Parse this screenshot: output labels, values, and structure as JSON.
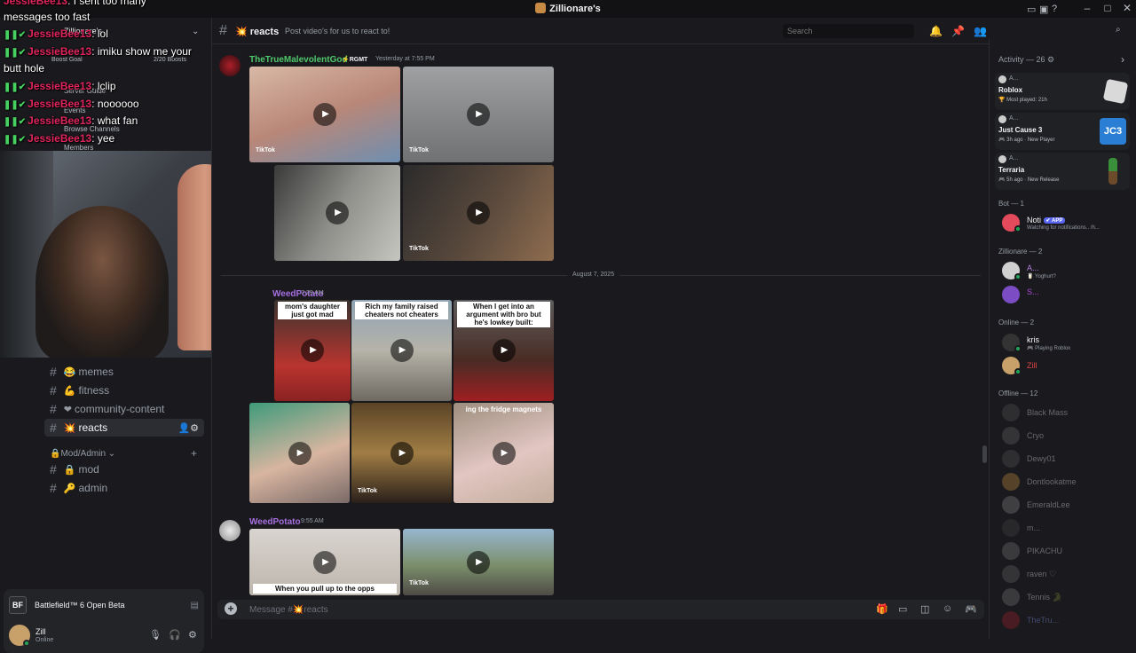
{
  "window": {
    "title": "Zillionare's"
  },
  "sidebar": {
    "channels": [
      {
        "emoji": "😂",
        "label": "memes",
        "top": 0
      },
      {
        "emoji": "💪",
        "label": "fitness"
      },
      {
        "emoji": "❤",
        "label": "community-content"
      },
      {
        "emoji": "💥",
        "label": "reacts",
        "active": true
      }
    ],
    "category": "Mod/Admin",
    "admin_channels": [
      {
        "emoji": "🔒",
        "label": "mod"
      },
      {
        "emoji": "🔑",
        "label": "admin"
      }
    ],
    "under_overlay": {
      "server_name": "Zillionare's",
      "boost_goal": "Boost Goal",
      "boosts": "2/20 Boosts",
      "server_guide": "Server Guide",
      "events": "Events",
      "browse": "Browse Channels",
      "members": "Members"
    }
  },
  "stream_chat": [
    {
      "name": "JessieBee13",
      "text": ": I sent too many"
    },
    {
      "name": "",
      "text": "messages too fast"
    },
    {
      "name": "JessieBee13",
      "text": ": lol"
    },
    {
      "name": "JessieBee13",
      "text": ": imiku show me your"
    },
    {
      "name": "",
      "text": "butt hole"
    },
    {
      "name": "JessieBee13",
      "text": ": lclip"
    },
    {
      "name": "JessieBee13",
      "text": ": noooooo"
    },
    {
      "name": "JessieBee13",
      "text": ": what fan"
    },
    {
      "name": "JessieBee13",
      "text": ": yee"
    }
  ],
  "game_activity": {
    "name": "Battlefield™ 6 Open Beta",
    "icon_text": "BF"
  },
  "user": {
    "name": "Zill",
    "status": "Online"
  },
  "channel_header": {
    "name": "reacts",
    "emoji": "💥",
    "topic": "Post video's for us to react to!"
  },
  "search": {
    "placeholder": "Search"
  },
  "messages": [
    {
      "author": "TheTrueMalevolentGod",
      "tag": "⚡RGMT",
      "time": "Yesterday at 7:55 PM"
    },
    {
      "author": "WeedPotato",
      "time": "7:29 AM"
    },
    {
      "author": "WeedPotato",
      "time": "9:55 AM"
    }
  ],
  "captions": {
    "v1": "mom's daughter just got mad",
    "v2": "Rich my family raised cheaters not cheaters",
    "v3": "When I get into an argument with bro but he's lowkey built:",
    "v4": "ing the fridge magnets",
    "v5": "When you pull up to the opps"
  },
  "tiktok": {
    "label": "TikTok"
  },
  "date_divider": "August 7, 2025",
  "composer": {
    "placeholder": "Message #💥reacts"
  },
  "activity": {
    "header": "Activity — 26",
    "cards": [
      {
        "who": "A...",
        "game": "Roblox",
        "meta": "Most played: 21h",
        "art": "#d9d9d9"
      },
      {
        "who": "A...",
        "game": "Just Cause 3",
        "meta": "3h ago · New Player",
        "art": "#2a7fd4"
      },
      {
        "who": "A...",
        "game": "Terraria",
        "meta": "5h ago · New Release",
        "art": "#3a8f3a"
      }
    ]
  },
  "member_groups": {
    "bot": "Bot — 1",
    "zillionare": "Zillionare — 2",
    "online": "Online — 2",
    "offline": "Offline — 12"
  },
  "members": {
    "bot": [
      {
        "name": "Noti",
        "badge": "✔ APP",
        "sub": "Watching for notifications.. /h...",
        "color": "#e34b5c"
      }
    ],
    "zillionare": [
      {
        "name": "A...",
        "sub": "🥛 Yoghurt?",
        "color": "#d0d0d0",
        "name_color": "#b57edc"
      },
      {
        "name": "S...",
        "sub": "",
        "color": "#7b4cc4",
        "name_color": "#b04bd9"
      }
    ],
    "online": [
      {
        "name": "kris",
        "sub": "🎮 Playing Roblox",
        "color": "#333"
      },
      {
        "name": "Zill",
        "sub": "",
        "color": "#c8a06a",
        "name_color": "#e04545"
      }
    ],
    "offline": [
      "Black Mass",
      "Cryo",
      "Dewy01",
      "Dontlookatme",
      "EmeraldLee",
      "m...",
      "PIKACHU",
      "raven ♡",
      "Tennis 🐊",
      "TheTru..."
    ]
  }
}
